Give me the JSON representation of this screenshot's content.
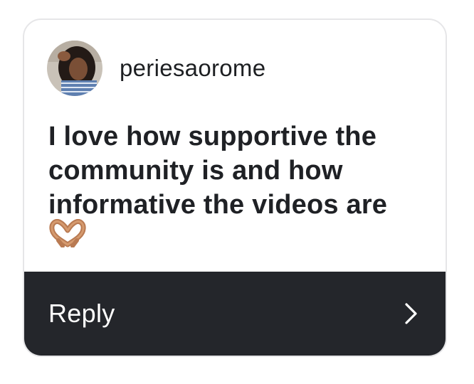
{
  "comment": {
    "username": "periesaorome",
    "avatar_icon": "profile-photo",
    "text": "I love how supportive the community is and how informative the videos are",
    "emoji": "heart-hands-emoji"
  },
  "reply_bar": {
    "label": "Reply",
    "icon": "chevron-right-icon",
    "background": "#24262b"
  }
}
